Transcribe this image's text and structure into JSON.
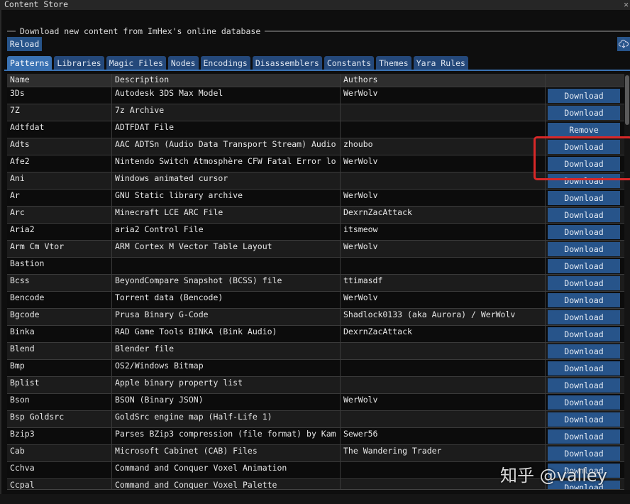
{
  "window": {
    "title": "Content Store"
  },
  "section_label": "Download new content from ImHex's online database",
  "toolbar": {
    "reload_label": "Reload",
    "cloud_icon": "cloud-download-icon"
  },
  "tabs": [
    {
      "label": "Patterns",
      "active": true
    },
    {
      "label": "Libraries"
    },
    {
      "label": "Magic Files"
    },
    {
      "label": "Nodes"
    },
    {
      "label": "Encodings"
    },
    {
      "label": "Disassemblers"
    },
    {
      "label": "Constants"
    },
    {
      "label": "Themes"
    },
    {
      "label": "Yara Rules"
    }
  ],
  "table": {
    "columns": [
      "Name",
      "Description",
      "Authors",
      ""
    ],
    "rows": [
      [
        "3Ds",
        "Autodesk 3DS Max Model",
        "WerWolv",
        "Download"
      ],
      [
        "7Z",
        "7z Archive",
        "",
        "Download"
      ],
      [
        "Adtfdat",
        "ADTFDAT File",
        "",
        "Remove"
      ],
      [
        "Adts",
        "AAC ADTSn (Audio Data Transport Stream) Audio",
        "zhoubo",
        "Download"
      ],
      [
        "Afe2",
        "Nintendo Switch Atmosphère CFW Fatal Error lo",
        "WerWolv",
        "Download"
      ],
      [
        "Ani",
        "Windows animated cursor",
        "",
        "Download"
      ],
      [
        "Ar",
        "GNU Static library archive",
        "WerWolv",
        "Download"
      ],
      [
        "Arc",
        "Minecraft LCE ARC File",
        "DexrnZacAttack",
        "Download"
      ],
      [
        "Aria2",
        "aria2 Control File",
        "itsmeow",
        "Download"
      ],
      [
        "Arm Cm Vtor",
        "ARM Cortex M Vector Table Layout",
        "WerWolv",
        "Download"
      ],
      [
        "Bastion",
        "",
        "",
        "Download"
      ],
      [
        "Bcss",
        "BeyondCompare Snapshot (BCSS) file",
        "ttimasdf",
        "Download"
      ],
      [
        "Bencode",
        "Torrent data (Bencode)",
        "WerWolv",
        "Download"
      ],
      [
        "Bgcode",
        "Prusa Binary G-Code",
        "Shadlock0133 (aka Aurora) / WerWolv",
        "Download"
      ],
      [
        "Binka",
        "RAD Game Tools BINKA (Bink Audio)",
        "DexrnZacAttack",
        "Download"
      ],
      [
        "Blend",
        "Blender file",
        "",
        "Download"
      ],
      [
        "Bmp",
        "OS2/Windows Bitmap",
        "",
        "Download"
      ],
      [
        "Bplist",
        "Apple binary property list",
        "",
        "Download"
      ],
      [
        "Bson",
        "BSON (Binary JSON)",
        "WerWolv",
        "Download"
      ],
      [
        "Bsp Goldsrc",
        "GoldSrc engine map (Half-Life 1)",
        "",
        "Download"
      ],
      [
        "Bzip3",
        "Parses BZip3 compression (file format) by Kam",
        "Sewer56",
        "Download"
      ],
      [
        "Cab",
        "Microsoft Cabinet (CAB) Files",
        "The Wandering Trader",
        "Download"
      ],
      [
        "Cchva",
        "Command and Conquer Voxel Animation",
        "",
        "Download"
      ],
      [
        "Ccpal",
        "Command and Conquer Voxel Palette",
        "",
        "Download"
      ]
    ]
  },
  "watermark": "知乎 @valley",
  "colors": {
    "button": "#27548a",
    "tab_active": "#3a72b3",
    "highlight_box": "#d82828"
  }
}
